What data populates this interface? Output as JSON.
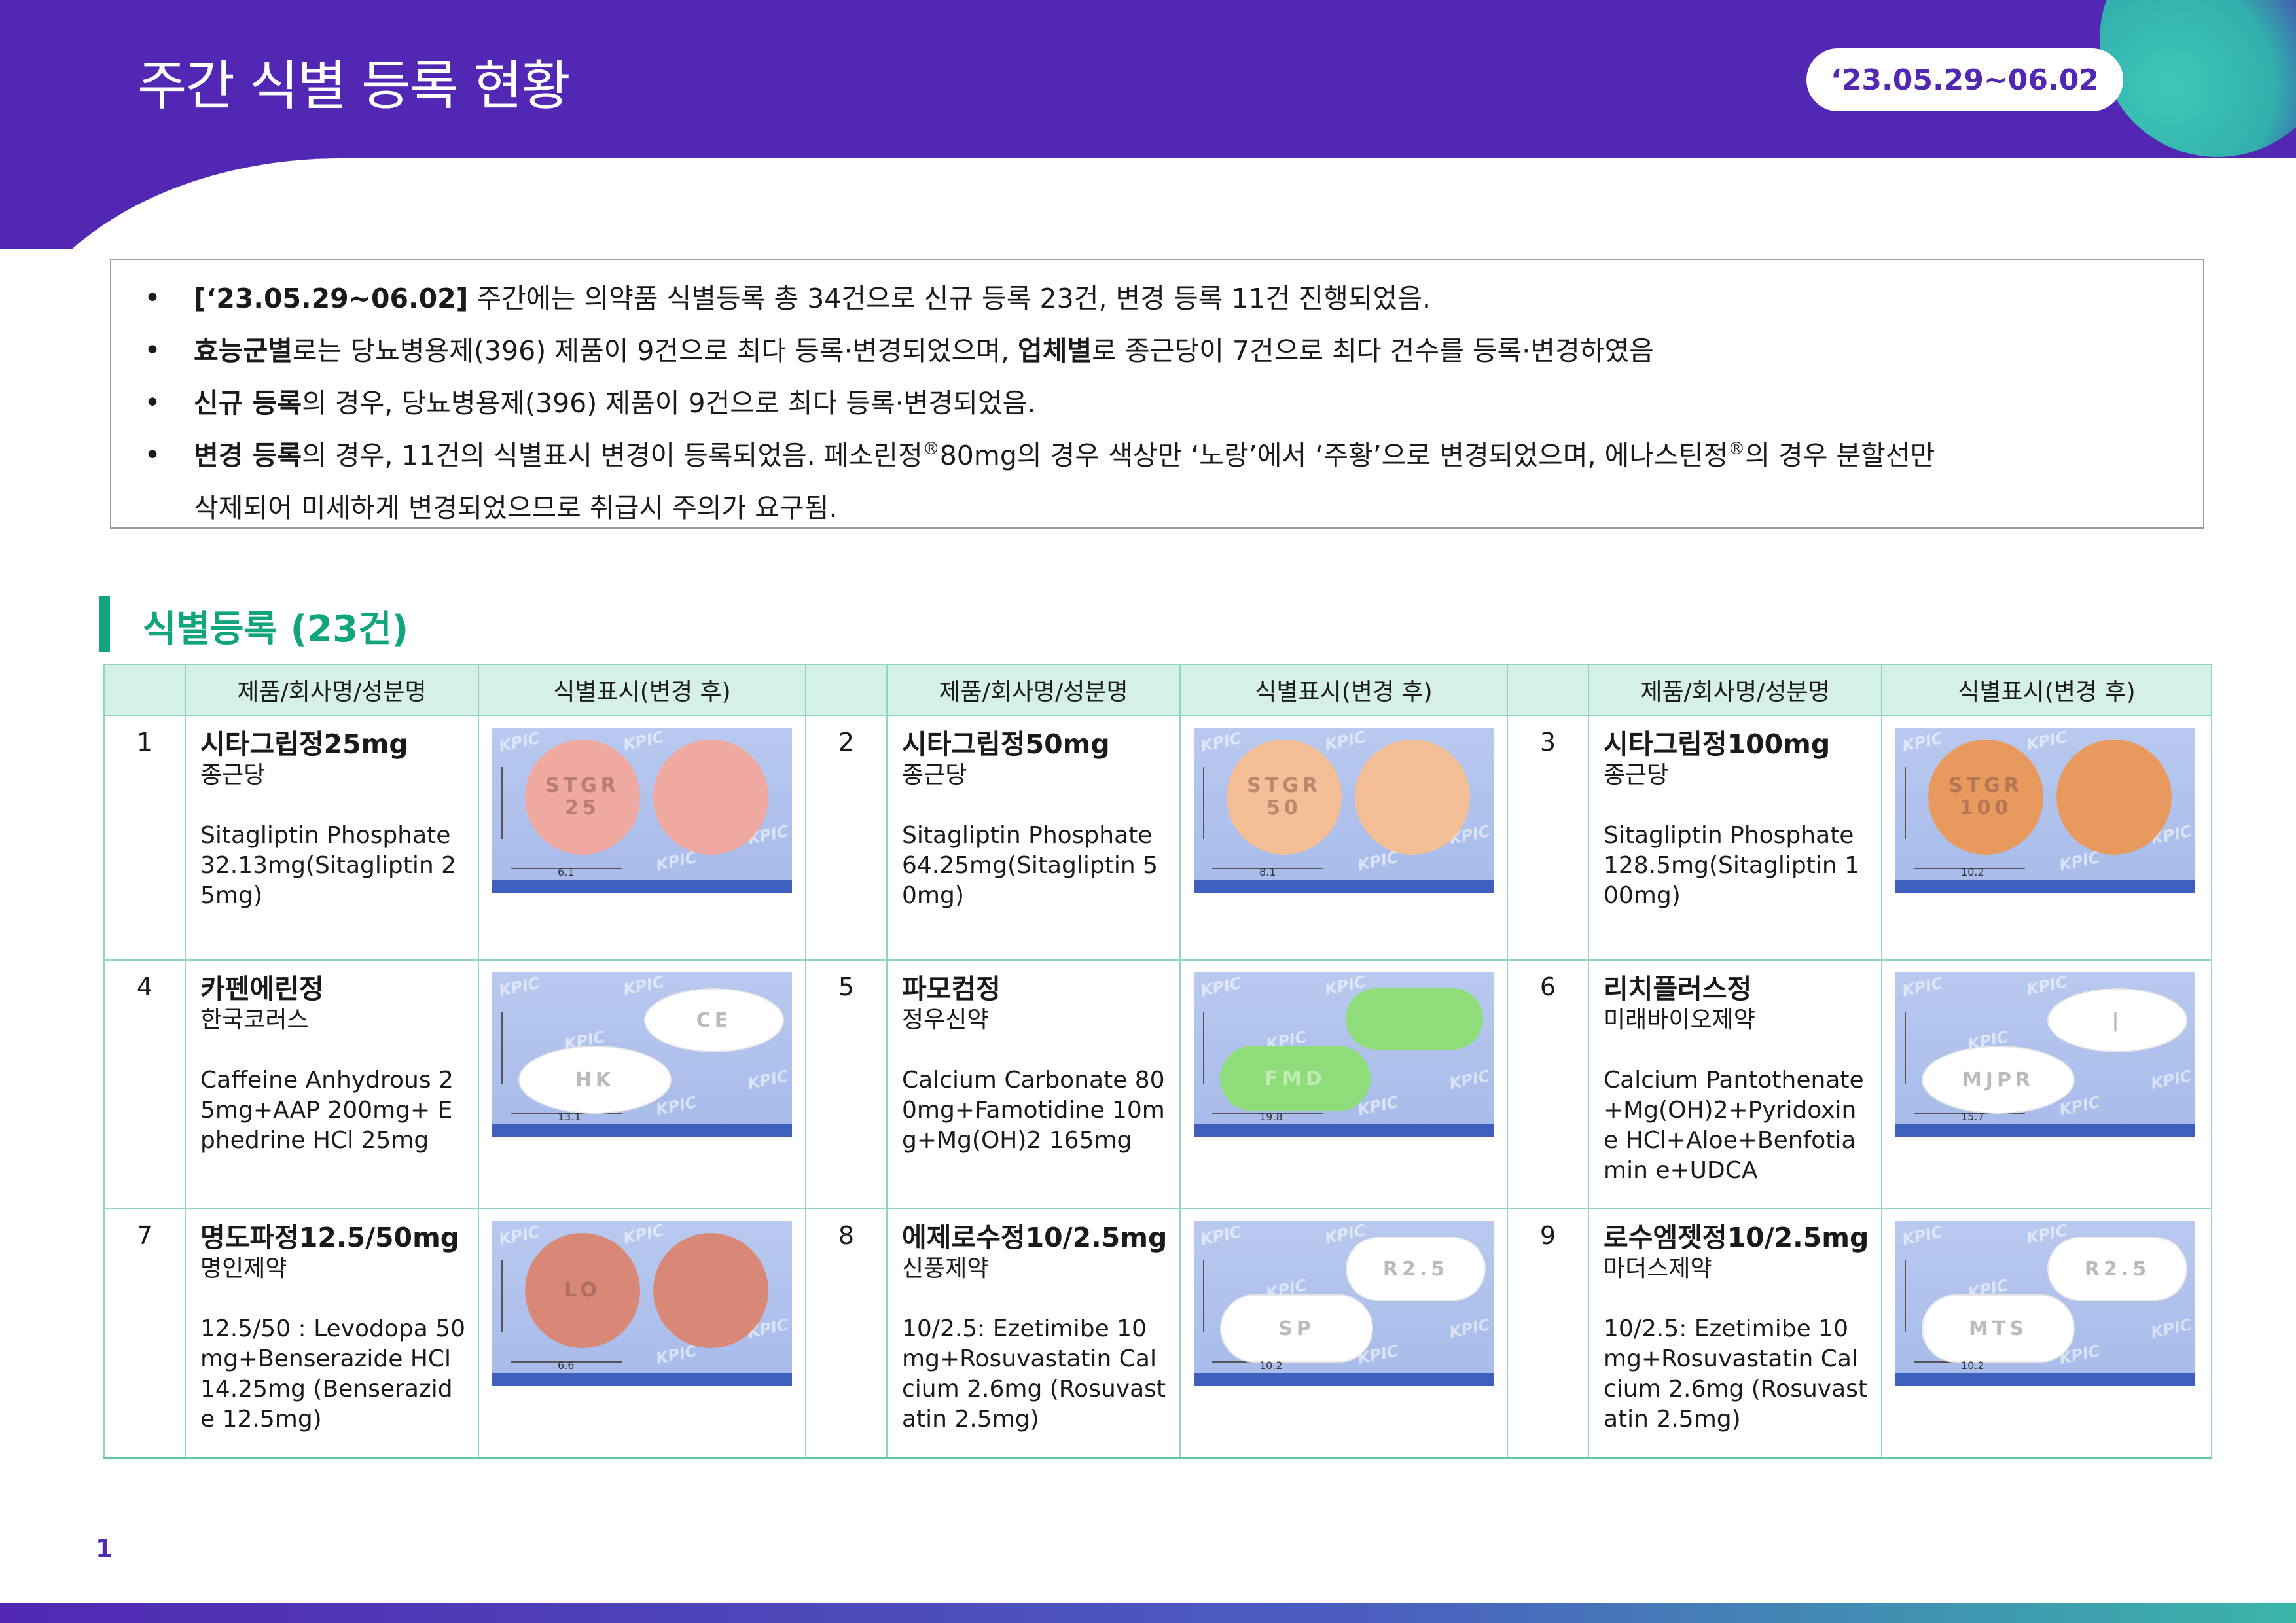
{
  "header": {
    "title": "주간 식별 등록 현황",
    "date_range": "‘23.05.29~06.02"
  },
  "summary": {
    "bullets": [
      {
        "b1": "[‘23.05.29~06.02]",
        "t1": " 주간에는 의약품 식별등록 총 34건으로 신규 등록 23건, 변경 등록 11건 진행되었음."
      },
      {
        "b1": "효능군별",
        "t1": "로는 당뇨병용제(396) 제품이 9건으로 최다 등록·변경되었으며, ",
        "b2": "업체별",
        "t2": "로 종근당이 7건으로 최다 건수를 등록·변경하였음"
      },
      {
        "b1": "신규 등록",
        "t1": "의 경우, 당뇨병용제(396) 제품이 9건으로 최다 등록·변경되었음."
      },
      {
        "b1": "변경 등록",
        "t1": "의 경우, 11건의 식별표시 변경이 등록되었음. 페소린정",
        "reg": "®",
        "t2": "80mg의 경우 색상만 ‘노랑’에서 ‘주황’으로 변경되었으며, 에나스틴정",
        "t3": "의 경우 분할선만",
        "t4": "삭제되어 미세하게 변경되었으므로 취급시 주의가 요구됨."
      }
    ]
  },
  "section": {
    "title": "식별등록 (23건)"
  },
  "table": {
    "headers": {
      "product": "제품/회사명/성분명",
      "image": "식별표시(변경 후)"
    },
    "items": [
      {
        "no": "1",
        "name": "시타그립정25mg",
        "company": "종근당",
        "ingredient": "Sitagliptin Phosphate 32.13mg(Sitagliptin 25mg)",
        "pill_color": "#f0a9a0",
        "pill_shape": "round",
        "imprint": "STGR 25",
        "dim": "6.1"
      },
      {
        "no": "2",
        "name": "시타그립정50mg",
        "company": "종근당",
        "ingredient": "Sitagliptin Phosphate 64.25mg(Sitagliptin 50mg)",
        "pill_color": "#f4bf96",
        "pill_shape": "round",
        "imprint": "STGR 50",
        "dim": "8.1"
      },
      {
        "no": "3",
        "name": "시타그립정100mg",
        "company": "종근당",
        "ingredient": "Sitagliptin Phosphate 128.5mg(Sitagliptin 100mg)",
        "pill_color": "#e89a5e",
        "pill_shape": "round",
        "imprint": "STGR 100",
        "dim": "10.2"
      },
      {
        "no": "4",
        "name": "카펜에린정",
        "company": "한국코러스",
        "ingredient": "Caffeine Anhydrous 25mg+AAP 200mg+ Ephedrine HCl 25mg",
        "pill_color": "#ffffff",
        "pill_shape": "oval",
        "imprint": "HK",
        "imprint2": "CE",
        "dim": "13.1"
      },
      {
        "no": "5",
        "name": "파모컴정",
        "company": "정우신약",
        "ingredient": "Calcium Carbonate 800mg+Famotidine 10mg+Mg(OH)2 165mg",
        "pill_color": "#8fdc7a",
        "pill_shape": "oblong",
        "imprint": "FMD",
        "dim": "19.8"
      },
      {
        "no": "6",
        "name": "리치플러스정",
        "company": "미래바이오제약",
        "ingredient": "Calcium Pantothenate +Mg(OH)2+Pyridoxine HCl+Aloe+Benfotiamin e+UDCA",
        "pill_color": "#ffffff",
        "pill_shape": "oval",
        "imprint": "MJPR",
        "imprint2": "|",
        "dim": "15.7"
      },
      {
        "no": "7",
        "name": "명도파정12.5/50mg",
        "company": "명인제약",
        "ingredient": "12.5/50 : Levodopa 50mg+Benserazide HCl 14.25mg (Benserazide 12.5mg)",
        "pill_color": "#d98878",
        "pill_shape": "round",
        "imprint": "LO",
        "dim": "6.6"
      },
      {
        "no": "8",
        "name": "에제로수정10/2.5mg",
        "company": "신풍제약",
        "ingredient": "10/2.5: Ezetimibe 10mg+Rosuvastatin Calcium 2.6mg (Rosuvastatin 2.5mg)",
        "pill_color": "#ffffff",
        "pill_shape": "oblong",
        "imprint": "SP",
        "imprint2": "R2.5",
        "dim": "10.2"
      },
      {
        "no": "9",
        "name": "로수엠젯정10/2.5mg",
        "company": "마더스제약",
        "ingredient": "10/2.5: Ezetimibe 10mg+Rosuvastatin Calcium 2.6mg (Rosuvastatin 2.5mg)",
        "pill_color": "#ffffff",
        "pill_shape": "oblong",
        "imprint": "MTS",
        "imprint2": "R2.5",
        "dim": "10.2"
      }
    ]
  },
  "footer": {
    "page": "1"
  },
  "colors": {
    "brand": "#5127b3",
    "accent": "#11a57e",
    "table_header_bg": "#d4f0e7"
  }
}
